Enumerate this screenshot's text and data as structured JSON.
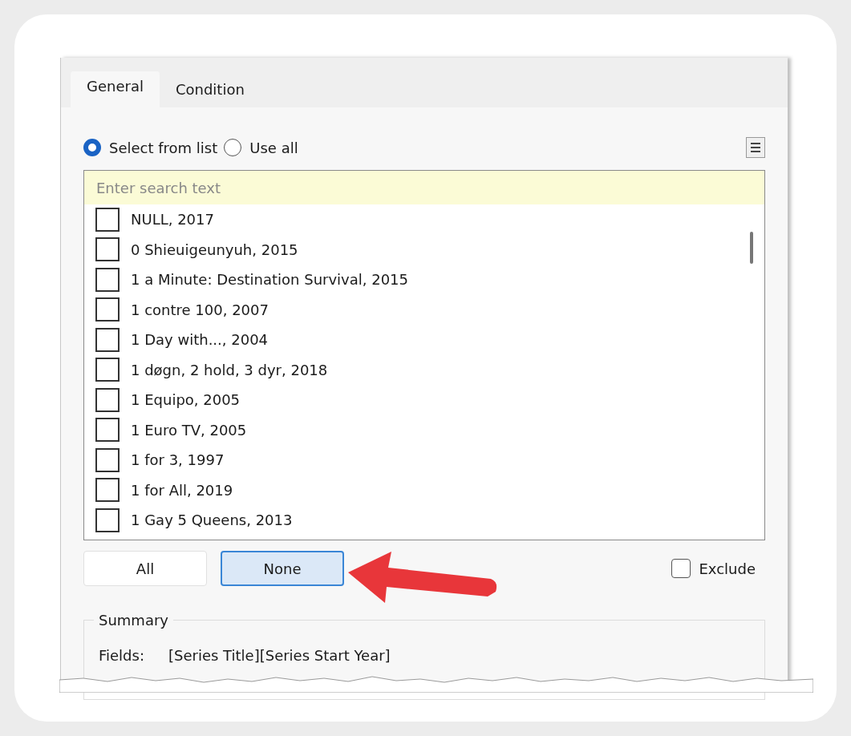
{
  "tabs": [
    {
      "label": "General",
      "selected": true
    },
    {
      "label": "Condition",
      "selected": false
    }
  ],
  "selection_mode": [
    {
      "label": "Select from list",
      "selected": true
    },
    {
      "label": "Use all",
      "selected": false
    }
  ],
  "search": {
    "placeholder": "Enter search text"
  },
  "items": [
    {
      "label": "NULL, 2017",
      "checked": false
    },
    {
      "label": "0 Shieuigeunyuh, 2015",
      "checked": false
    },
    {
      "label": "1 a Minute: Destination Survival, 2015",
      "checked": false
    },
    {
      "label": "1 contre 100, 2007",
      "checked": false
    },
    {
      "label": "1 Day with..., 2004",
      "checked": false
    },
    {
      "label": "1 døgn, 2 hold, 3 dyr, 2018",
      "checked": false
    },
    {
      "label": "1 Equipo, 2005",
      "checked": false
    },
    {
      "label": "1 Euro TV, 2005",
      "checked": false
    },
    {
      "label": "1 for 3, 1997",
      "checked": false
    },
    {
      "label": "1 for All, 2019",
      "checked": false
    },
    {
      "label": "1 Gay 5 Queens, 2013",
      "checked": false
    }
  ],
  "buttons": [
    {
      "label": "All",
      "highlighted": false
    },
    {
      "label": "None",
      "highlighted": true
    }
  ],
  "exclude": {
    "label": "Exclude",
    "checked": false
  },
  "summary": {
    "title": "Summary",
    "fields_label": "Fields:",
    "fields_value": "[Series Title][Series Start Year]"
  }
}
